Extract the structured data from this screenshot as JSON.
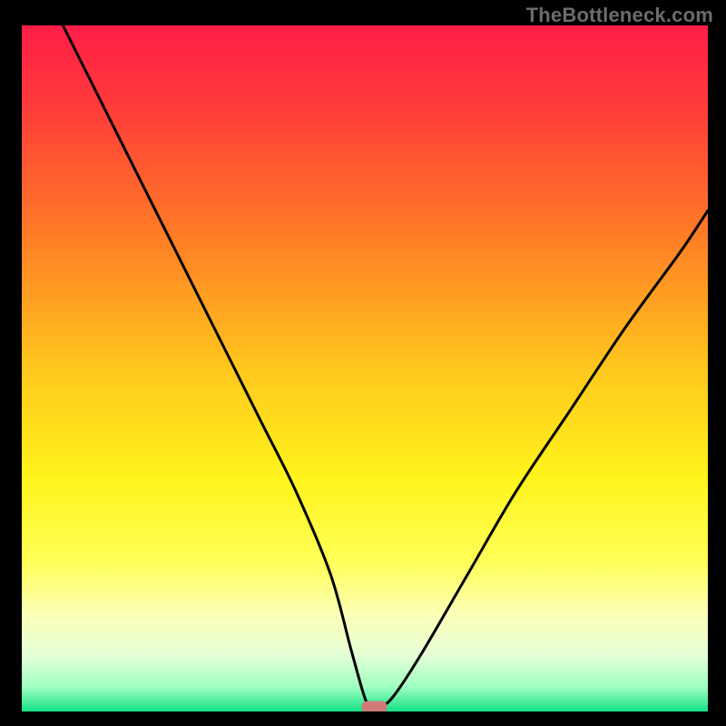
{
  "watermark": "TheBottleneck.com",
  "colors": {
    "background": "#000000",
    "watermark_text": "#6c6c6c",
    "curve": "#000000",
    "marker": "#cf7a79",
    "gradient_stops": [
      {
        "offset": 0.0,
        "color": "#ff1d48"
      },
      {
        "offset": 0.12,
        "color": "#ff3c3a"
      },
      {
        "offset": 0.3,
        "color": "#ff7a26"
      },
      {
        "offset": 0.5,
        "color": "#ffc71d"
      },
      {
        "offset": 0.66,
        "color": "#fff41c"
      },
      {
        "offset": 0.78,
        "color": "#ffff56"
      },
      {
        "offset": 0.86,
        "color": "#fcffb8"
      },
      {
        "offset": 0.92,
        "color": "#e3ffd7"
      },
      {
        "offset": 0.965,
        "color": "#9dffc1"
      },
      {
        "offset": 1.0,
        "color": "#13e086"
      }
    ]
  },
  "chart_data": {
    "type": "line",
    "title": "",
    "xlabel": "",
    "ylabel": "",
    "xlim": [
      0,
      100
    ],
    "ylim": [
      0,
      100
    ],
    "grid": false,
    "legend": false,
    "series": [
      {
        "name": "bottleneck-curve",
        "x": [
          6,
          10,
          15,
          20,
          25,
          30,
          35,
          40,
          45,
          48,
          50,
          51,
          52,
          54,
          58,
          65,
          72,
          80,
          88,
          96,
          100
        ],
        "y": [
          100,
          92,
          82,
          72,
          62,
          52,
          42,
          32,
          20,
          9,
          2,
          0.6,
          0.6,
          2,
          8,
          20,
          32,
          44,
          56,
          67,
          73
        ]
      }
    ],
    "markers": [
      {
        "name": "optimal-point",
        "x": 51.4,
        "y": 0.6
      }
    ],
    "notes": "y expresses bottleneck percentage (100 = worst at top, 0 = ideal at bottom); minimum of curve occurs near x≈51."
  }
}
